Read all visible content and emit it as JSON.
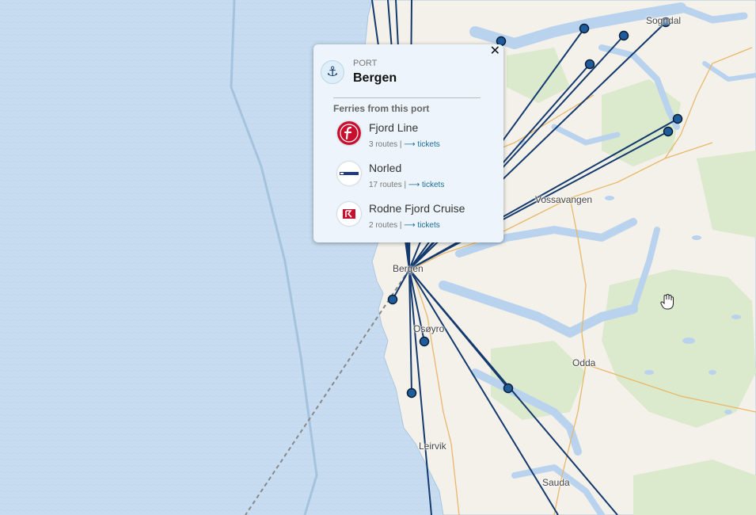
{
  "map": {
    "places": [
      {
        "name": "Sogndal"
      },
      {
        "name": "Vossavangen"
      },
      {
        "name": "Bergen"
      },
      {
        "name": "Osøyro"
      },
      {
        "name": "Odda"
      },
      {
        "name": "Leirvik"
      },
      {
        "name": "Sauda"
      }
    ],
    "colors": {
      "sea": "#c7dcf0",
      "land": "#f4f1ea",
      "forest": "#dbe9cc",
      "route": "#143a6e",
      "port_fill": "#1f5c99"
    }
  },
  "popup": {
    "kind": "PORT",
    "name": "Bergen",
    "close_icon": "close-icon",
    "type_icon": "anchor-icon",
    "ferries_title": "Ferries from this port",
    "operators": [
      {
        "name": "Fjord Line",
        "routes": "3 routes",
        "link": "⟶ tickets",
        "logo": "fjord-line-logo",
        "logo_color": "#c8102e"
      },
      {
        "name": "Norled",
        "routes": "17 routes",
        "link": "⟶ tickets",
        "logo": "norled-logo",
        "logo_color": "#1f3a8a"
      },
      {
        "name": "Rodne Fjord Cruise",
        "routes": "2 routes",
        "link": "⟶ tickets",
        "logo": "rodne-logo",
        "logo_color": "#c8102e"
      }
    ]
  }
}
